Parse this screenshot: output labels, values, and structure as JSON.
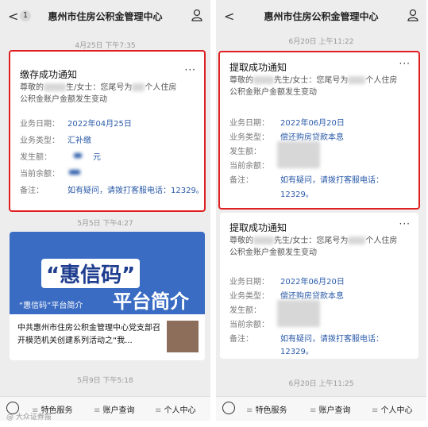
{
  "left": {
    "header": {
      "back": "<",
      "badge": "1",
      "title": "惠州市住房公积金管理中心"
    },
    "ts1": "4月25日 下午7:35",
    "card": {
      "title": "缴存成功通知",
      "dots": "···",
      "greeting": "尊敬的",
      "gender": "生/女士：您尾号为",
      "tail": "个人住房",
      "line2": "公积金账户金额发生变动",
      "rows": [
        {
          "label": "业务日期：",
          "value": "2022年04月25日"
        },
        {
          "label": "业务类型：",
          "value": "汇补缴"
        },
        {
          "label": "发生额：",
          "value": "元"
        },
        {
          "label": "当前余额：",
          "value": ""
        },
        {
          "label": "备注：",
          "value": "如有疑问，请拨打客服电话：12329。"
        }
      ]
    },
    "ts2": "5月5日 下午4:27",
    "banner": {
      "line1": "“惠信码”",
      "line2": "平台简介",
      "caption": "“惠信码”平台简介"
    },
    "article": "中共惠州市住房公积金管理中心党支部召开模范机关创建系列活动之“我...",
    "ts3": "5月9日 下午5:18",
    "menu": [
      "特色服务",
      "账户查询",
      "个人中心"
    ]
  },
  "right": {
    "header": {
      "back": "<",
      "title": "惠州市住房公积金管理中心"
    },
    "ts1": "6月20日 上午11:22",
    "card1": {
      "title": "提取成功通知",
      "dots": "···",
      "greeting": "尊敬的",
      "gender": "先生/女士：您尾号为",
      "tail": "个人住房",
      "line2": "公积金账户金额发生变动",
      "rows": [
        {
          "label": "业务日期：",
          "value": "2022年06月20日"
        },
        {
          "label": "业务类型：",
          "value": "偿还购房贷款本息"
        },
        {
          "label": "发生额：",
          "value": ""
        },
        {
          "label": "当前余额：",
          "value": ""
        },
        {
          "label": "备注：",
          "value": "如有疑问，请拨打客服电话："
        }
      ],
      "remark2": "12329。"
    },
    "card2": {
      "title": "提取成功通知",
      "dots": "···",
      "greeting": "尊敬的",
      "gender": "先生/女士：您尾号为",
      "tail": "个人住房",
      "line2": "公积金账户金额发生变动",
      "rows": [
        {
          "label": "业务日期：",
          "value": "2022年06月20日"
        },
        {
          "label": "业务类型：",
          "value": "偿还购房贷款本息"
        },
        {
          "label": "发生额：",
          "value": ""
        },
        {
          "label": "当前余额：",
          "value": ""
        },
        {
          "label": "备注：",
          "value": "如有疑问，请拨打客服电话："
        }
      ],
      "remark2": "12329。"
    },
    "ts2": "6月20日 上午11:25",
    "menu": [
      "特色服务",
      "账户查询",
      "个人中心"
    ]
  },
  "watermark": "@ 大众证券报",
  "colors": {
    "highlight": "#e02020",
    "link": "#2a5aa8",
    "background": "#ededed"
  }
}
